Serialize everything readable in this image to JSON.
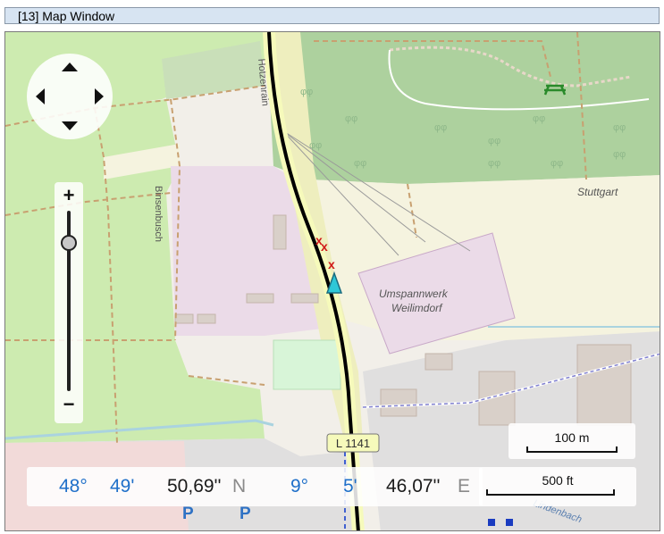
{
  "window": {
    "title": "[13] Map Window"
  },
  "map": {
    "labels": {
      "road_ref": "L 1141",
      "street_north": "Hotzenrain",
      "street_west": "Binsenbusch",
      "place_stuttgart": "Stuttgart",
      "substation_line1": "Umspannwerk",
      "substation_line2": "Weilimdorf",
      "parking": "P",
      "stream": "Lindenbach"
    },
    "marker_glyph": "x",
    "colors": {
      "forest": "#add19e",
      "meadow": "#cdebb0",
      "industrial": "#ebdbe8",
      "track": "#000000",
      "position": "#2ec8d8",
      "marker": "#d01818"
    }
  },
  "controls": {
    "pan": {
      "up_icon": "pan-up-icon",
      "down_icon": "pan-down-icon",
      "left_icon": "pan-left-icon",
      "right_icon": "pan-right-icon"
    },
    "zoom": {
      "plus": "+",
      "minus": "−",
      "level": 0.82
    },
    "scale": {
      "metric": "100 m",
      "imperial": "500 ft"
    }
  },
  "coords": {
    "lat_deg": "48°",
    "lat_min": "49'",
    "lat_sec": "50,69''",
    "lat_hem": "N",
    "lon_deg": "9°",
    "lon_min": "5'",
    "lon_sec": "46,07''",
    "lon_hem": "E"
  }
}
